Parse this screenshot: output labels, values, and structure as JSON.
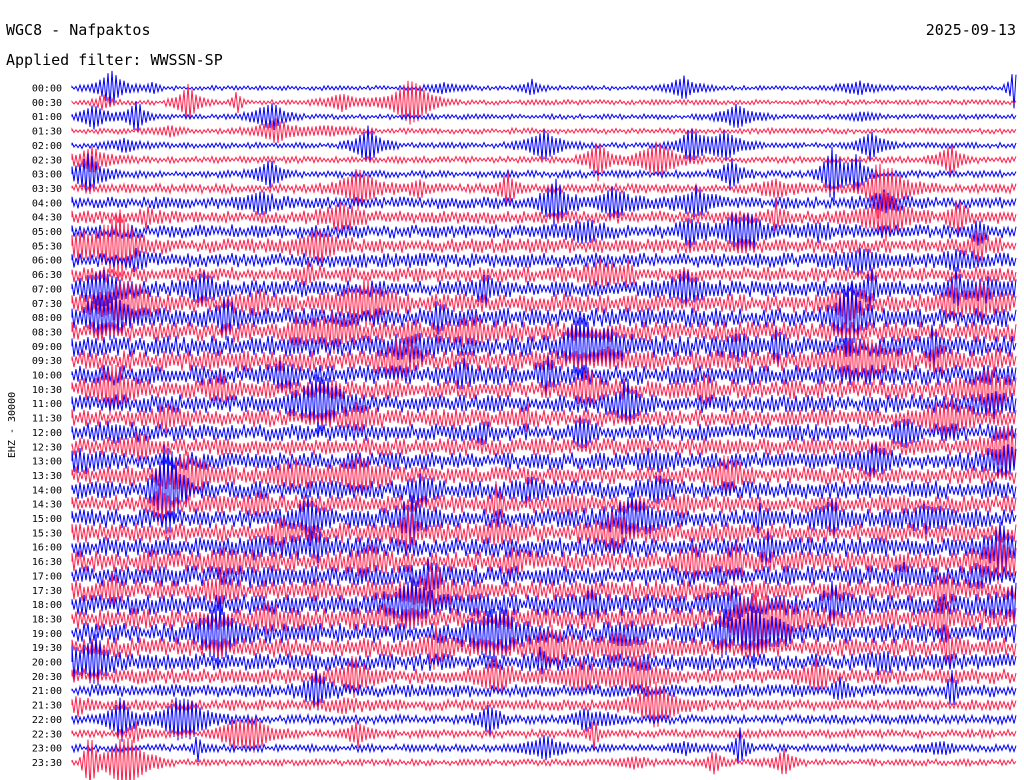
{
  "header": {
    "station": "WGC8 - Nafpaktos",
    "date": "2025-09-13",
    "filter": "Applied filter: WWSSN-SP"
  },
  "chart_data": {
    "type": "line",
    "title": "WGC8 - Nafpaktos",
    "subtitle": "Applied filter: WWSSN-SP",
    "ylabel": "EHZ - 30000",
    "colors": [
      "#0000ff",
      "#ff1f4a"
    ],
    "rows": [
      {
        "label": "00:00",
        "level": 0.1
      },
      {
        "label": "00:30",
        "level": 0.12
      },
      {
        "label": "01:00",
        "level": 0.12
      },
      {
        "label": "01:30",
        "level": 0.15
      },
      {
        "label": "02:00",
        "level": 0.15
      },
      {
        "label": "02:30",
        "level": 0.2
      },
      {
        "label": "03:00",
        "level": 0.25
      },
      {
        "label": "03:30",
        "level": 0.35
      },
      {
        "label": "04:00",
        "level": 0.5
      },
      {
        "label": "04:30",
        "level": 0.55
      },
      {
        "label": "05:00",
        "level": 0.6
      },
      {
        "label": "05:30",
        "level": 0.65
      },
      {
        "label": "06:00",
        "level": 0.65
      },
      {
        "label": "06:30",
        "level": 0.7
      },
      {
        "label": "07:00",
        "level": 0.75
      },
      {
        "label": "07:30",
        "level": 0.85
      },
      {
        "label": "08:00",
        "level": 0.9
      },
      {
        "label": "08:30",
        "level": 0.95
      },
      {
        "label": "09:00",
        "level": 1.0
      },
      {
        "label": "09:30",
        "level": 1.0
      },
      {
        "label": "10:00",
        "level": 0.95
      },
      {
        "label": "10:30",
        "level": 0.9
      },
      {
        "label": "11:00",
        "level": 0.85
      },
      {
        "label": "11:30",
        "level": 0.8
      },
      {
        "label": "12:00",
        "level": 0.8
      },
      {
        "label": "12:30",
        "level": 0.8
      },
      {
        "label": "13:00",
        "level": 0.8
      },
      {
        "label": "13:30",
        "level": 0.8
      },
      {
        "label": "14:00",
        "level": 0.85
      },
      {
        "label": "14:30",
        "level": 0.85
      },
      {
        "label": "15:00",
        "level": 0.9
      },
      {
        "label": "15:30",
        "level": 0.9
      },
      {
        "label": "16:00",
        "level": 0.95
      },
      {
        "label": "16:30",
        "level": 1.0
      },
      {
        "label": "17:00",
        "level": 1.0
      },
      {
        "label": "17:30",
        "level": 1.0
      },
      {
        "label": "18:00",
        "level": 1.0
      },
      {
        "label": "18:30",
        "level": 1.0
      },
      {
        "label": "19:00",
        "level": 0.95
      },
      {
        "label": "19:30",
        "level": 0.9
      },
      {
        "label": "20:00",
        "level": 0.8
      },
      {
        "label": "20:30",
        "level": 0.7
      },
      {
        "label": "21:00",
        "level": 0.55
      },
      {
        "label": "21:30",
        "level": 0.45
      },
      {
        "label": "22:00",
        "level": 0.35
      },
      {
        "label": "22:30",
        "level": 0.3
      },
      {
        "label": "23:00",
        "level": 0.25
      },
      {
        "label": "23:30",
        "level": 0.2
      }
    ]
  }
}
